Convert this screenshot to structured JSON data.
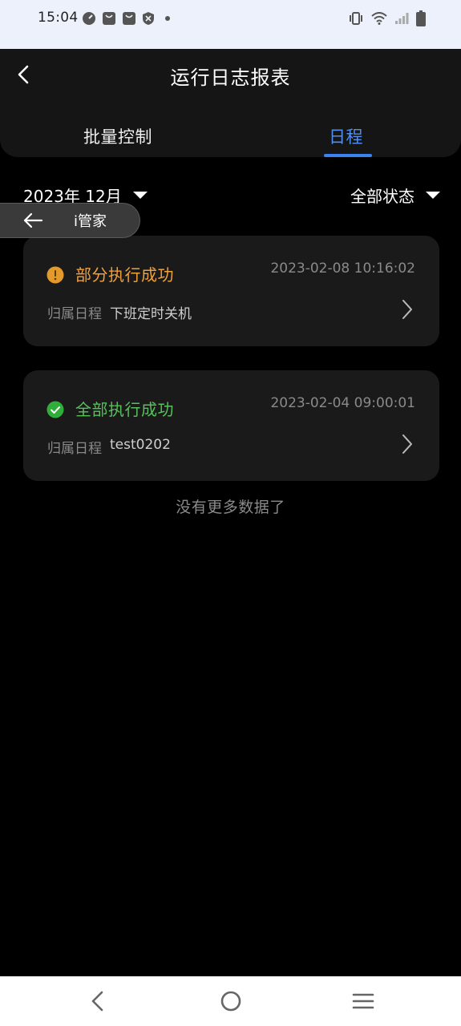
{
  "status_bar": {
    "time": "15:04"
  },
  "header": {
    "title": "运行日志报表",
    "tabs": [
      {
        "label": "批量控制",
        "active": false
      },
      {
        "label": "日程",
        "active": true
      }
    ]
  },
  "filters": {
    "month": "2023年 12月",
    "status": "全部状态"
  },
  "floating_pill": {
    "label": "i管家"
  },
  "logs": [
    {
      "status": "部分执行成功",
      "status_kind": "partial",
      "status_color": "#f0a03c",
      "timestamp": "2023-02-08 10:16:02",
      "belong_label": "归属日程",
      "schedule_name": "下班定时关机"
    },
    {
      "status": "全部执行成功",
      "status_kind": "success",
      "status_color": "#57c05c",
      "timestamp": "2023-02-04 09:00:01",
      "belong_label": "归属日程",
      "schedule_name": "test0202"
    }
  ],
  "list_footer": "没有更多数据了",
  "colors": {
    "accent": "#3c82ee",
    "background": "#000000",
    "card": "#1a1a1a"
  }
}
